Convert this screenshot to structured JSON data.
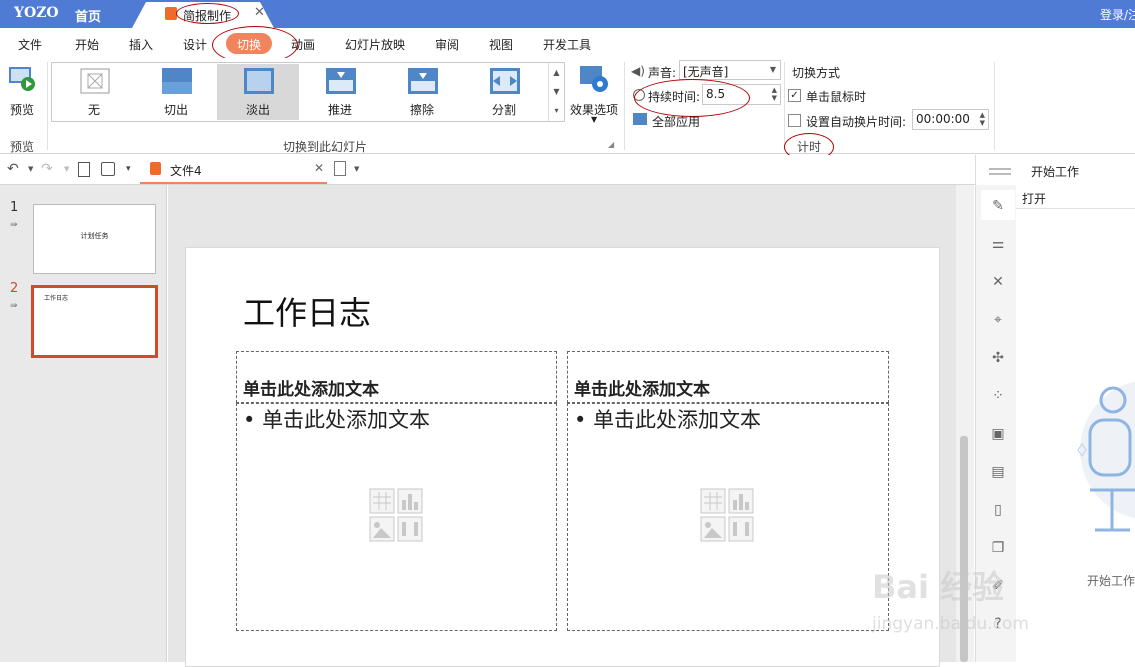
{
  "titlebar": {
    "logo": "YOZO",
    "home": "首页",
    "doc_tab": "简报制作",
    "login": "登录/注"
  },
  "menu": [
    "文件",
    "开始",
    "插入",
    "设计",
    "切换",
    "动画",
    "幻灯片放映",
    "审阅",
    "视图",
    "开发工具"
  ],
  "menu_active": "切换",
  "ribbon": {
    "preview_label": "预览",
    "preview_group": "预览",
    "gallery_items": [
      "无",
      "切出",
      "淡出",
      "推进",
      "擦除",
      "分割"
    ],
    "gallery_selected": "淡出",
    "gallery_group": "切换到此幻灯片",
    "effect_options": "效果选项",
    "sound_label": "声音:",
    "sound_value": "[无声音]",
    "duration_label": "持续时间:",
    "duration_value": "8.5",
    "apply_all": "全部应用",
    "advance_title": "切换方式",
    "on_click_label": "单击鼠标时",
    "on_click_checked": true,
    "auto_label": "设置自动换片时间:",
    "auto_checked": false,
    "auto_value": "00:00:00",
    "timing_group": "计时"
  },
  "doc_tab2": "文件4",
  "slides": [
    {
      "num": "1",
      "title": "计划任务"
    },
    {
      "num": "2",
      "title": "工作日志"
    }
  ],
  "slide": {
    "title": "工作日志",
    "left_header": "单击此处添加文本",
    "left_bullet": "单击此处添加文本",
    "right_header": "单击此处添加文本",
    "right_bullet": "单击此处添加文本"
  },
  "right_panel": {
    "header": "开始工作",
    "open": "打开",
    "footer": "开始工作"
  },
  "watermark": {
    "brand": "Bai 经验",
    "url": "jingyan.baidu.com"
  },
  "colors": {
    "titlebar": "#4f7bd4",
    "accent": "#f0845c",
    "selected_thumb": "#d24a2a",
    "annotation": "#b40000"
  }
}
